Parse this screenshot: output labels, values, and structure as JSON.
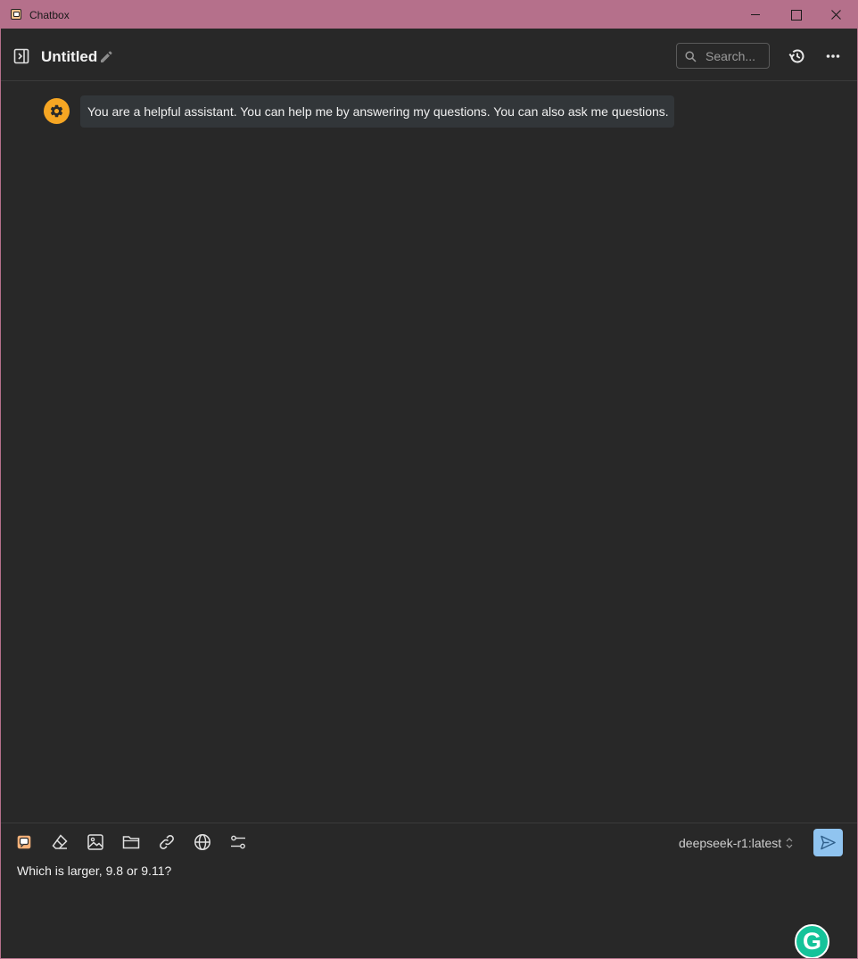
{
  "window": {
    "title": "Chatbox",
    "controls": [
      "minimize",
      "maximize",
      "close"
    ]
  },
  "header": {
    "title": "Untitled",
    "search_placeholder": "Search...",
    "icons": [
      "sidebar-toggle-icon",
      "edit-icon",
      "search-icon",
      "history-icon",
      "more-icon"
    ]
  },
  "messages": [
    {
      "role": "system",
      "avatar_icon": "gear-icon",
      "text": "You are a helpful assistant. You can help me by answering my questions. You can also ask me questions."
    }
  ],
  "composer": {
    "tools": [
      "chatbox-icon",
      "eraser-icon",
      "image-icon",
      "folder-icon",
      "link-icon",
      "globe-icon",
      "settings-sliders-icon"
    ],
    "model": "deepseek-r1:latest",
    "input_value": "Which is larger, 9.8 or 9.11?",
    "send_icon": "send-icon"
  },
  "overlays": {
    "grammarly_letter": "G"
  },
  "colors": {
    "titlebar": "#b5708b",
    "background": "#282828",
    "accent_orange": "#f6a623",
    "send_button": "#90c4f0",
    "grammarly": "#15c39a"
  }
}
